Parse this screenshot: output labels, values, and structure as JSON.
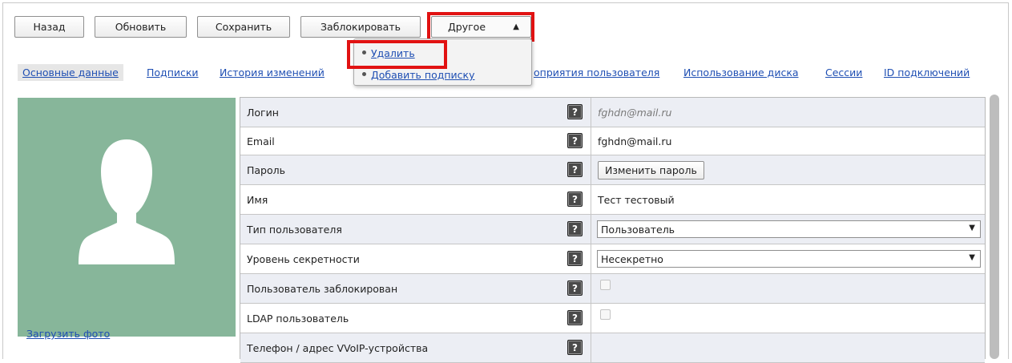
{
  "toolbar": {
    "back_label": "Назад",
    "refresh_label": "Обновить",
    "save_label": "Сохранить",
    "block_label": "Заблокировать",
    "other_label": "Другое"
  },
  "dropdown": {
    "items": [
      {
        "label": "Удалить"
      },
      {
        "label": "Добавить подписку"
      }
    ]
  },
  "tabs": [
    {
      "label": "Основные данные"
    },
    {
      "label": "Подписки"
    },
    {
      "label": "История изменений"
    },
    {
      "label": "оприятия пользователя"
    },
    {
      "label": "Использование диска"
    },
    {
      "label": "Сессии"
    },
    {
      "label": "ID подключений"
    }
  ],
  "photo": {
    "upload_label": "Загрузить фото"
  },
  "help_glyph": "?",
  "fields": {
    "login": {
      "label": "Логин",
      "value": "fghdn@mail.ru"
    },
    "email": {
      "label": "Email",
      "value": "fghdn@mail.ru"
    },
    "password": {
      "label": "Пароль",
      "button": "Изменить пароль"
    },
    "name": {
      "label": "Имя",
      "value": "Тест тестовый"
    },
    "user_type": {
      "label": "Тип пользователя",
      "selected": "Пользователь"
    },
    "secrecy": {
      "label": "Уровень секретности",
      "selected": "Несекретно"
    },
    "blocked": {
      "label": "Пользователь заблокирован",
      "checked": false
    },
    "ldap": {
      "label": "LDAP пользователь",
      "checked": false
    },
    "phone": {
      "label": "Телефон / адрес VVoIP-устройства",
      "value": ""
    }
  },
  "colors": {
    "accent_link": "#1f4fb3",
    "highlight": "#e11212",
    "photo_bg": "#87b69a",
    "row_alt": "#eceef4"
  }
}
